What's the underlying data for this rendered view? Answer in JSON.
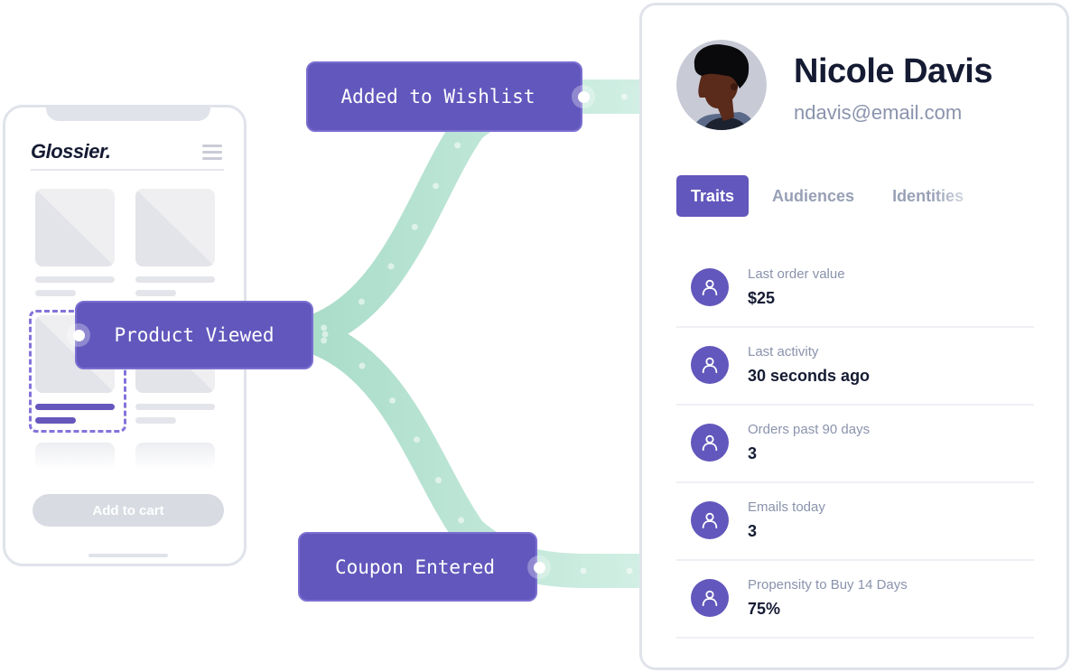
{
  "colors": {
    "accent": "#6257bc",
    "flow": "#b5e3d3",
    "text_dark": "#151b33",
    "text_muted": "#8a93ad",
    "border": "#e0e3ea"
  },
  "phone": {
    "brand": "Glossier.",
    "menu_icon": "hamburger-icon",
    "add_to_cart_label": "Add to cart"
  },
  "events": {
    "wishlist": "Added to Wishlist",
    "product_viewed": "Product Viewed",
    "coupon": "Coupon Entered"
  },
  "profile": {
    "name": "Nicole Davis",
    "email": "ndavis@email.com",
    "tabs": [
      {
        "label": "Traits",
        "active": true
      },
      {
        "label": "Audiences",
        "active": false
      },
      {
        "label": "Identities",
        "active": false
      }
    ],
    "traits": [
      {
        "icon": "user-icon",
        "label": "Last order value",
        "value": "$25"
      },
      {
        "icon": "user-icon",
        "label": "Last activity",
        "value": "30 seconds ago"
      },
      {
        "icon": "user-icon",
        "label": "Orders past 90 days",
        "value": "3"
      },
      {
        "icon": "user-icon",
        "label": "Emails today",
        "value": "3"
      },
      {
        "icon": "user-icon",
        "label": "Propensity to Buy 14 Days",
        "value": "75%"
      }
    ]
  }
}
